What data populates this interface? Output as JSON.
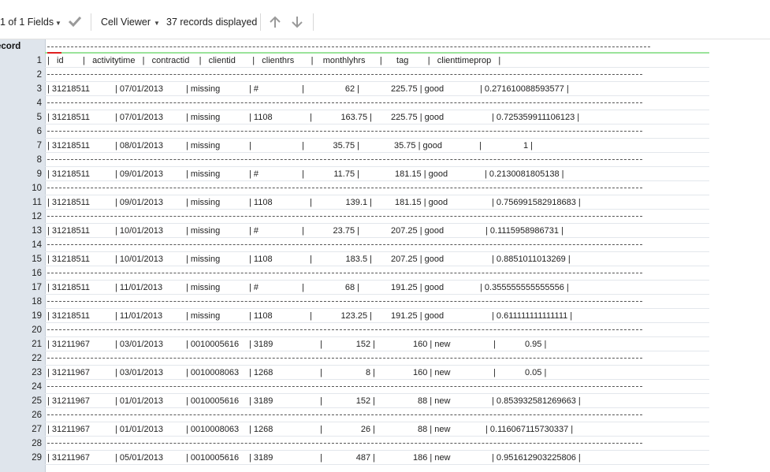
{
  "toolbar": {
    "fields_label": "1 of 1 Fields",
    "viewer_label": "Cell Viewer",
    "records_label": "37 records displayed"
  },
  "grid": {
    "rownum_header": "ecord",
    "header_row": "|   id        |   activitytime   |   contractid    |   clientid       |   clienthrs       |    monthlyhrs      |      tag        |   clienttimeprop   |",
    "rows": [
      {
        "n": "1",
        "kind": "header"
      },
      {
        "n": "2",
        "kind": "dash"
      },
      {
        "n": "3",
        "kind": "data",
        "c": [
          "| 31218511",
          "| 07/01/2013",
          "| missing",
          "| #",
          "62 |",
          "225.75 | good",
          "| 0.271610088593577 |"
        ]
      },
      {
        "n": "4",
        "kind": "dash"
      },
      {
        "n": "5",
        "kind": "data",
        "c": [
          "| 31218511",
          "| 07/01/2013",
          "| missing",
          "| 1108",
          "163.75 |",
          "225.75 | good",
          "| 0.725359911106123 |"
        ]
      },
      {
        "n": "6",
        "kind": "dash"
      },
      {
        "n": "7",
        "kind": "data",
        "c": [
          "| 31218511",
          "| 08/01/2013",
          "| missing",
          "|",
          "35.75 |",
          "35.75 | good",
          "1 |"
        ]
      },
      {
        "n": "8",
        "kind": "dash"
      },
      {
        "n": "9",
        "kind": "data",
        "c": [
          "| 31218511",
          "| 09/01/2013",
          "| missing",
          "| #",
          "11.75 |",
          "181.15 | good",
          "| 0.2130081805138 |"
        ]
      },
      {
        "n": "10",
        "kind": "dash"
      },
      {
        "n": "11",
        "kind": "data",
        "c": [
          "| 31218511",
          "| 09/01/2013",
          "| missing",
          "| 1108",
          "139.1 |",
          "181.15 | good",
          "| 0.756991582918683 |"
        ]
      },
      {
        "n": "12",
        "kind": "dash"
      },
      {
        "n": "13",
        "kind": "data",
        "c": [
          "| 31218511",
          "| 10/01/2013",
          "| missing",
          "| #",
          "23.75 |",
          "207.25 | good",
          "| 0.1115958986731 |"
        ]
      },
      {
        "n": "14",
        "kind": "dash"
      },
      {
        "n": "15",
        "kind": "data",
        "c": [
          "| 31218511",
          "| 10/01/2013",
          "| missing",
          "| 1108",
          "183.5 |",
          "207.25 | good",
          "| 0.8851011013269 |"
        ]
      },
      {
        "n": "16",
        "kind": "dash"
      },
      {
        "n": "17",
        "kind": "data",
        "c": [
          "| 31218511",
          "| 11/01/2013",
          "| missing",
          "| #",
          "68 |",
          "191.25 | good",
          "| 0.355555555555556 |"
        ]
      },
      {
        "n": "18",
        "kind": "dash"
      },
      {
        "n": "19",
        "kind": "data",
        "c": [
          "| 31218511",
          "| 11/01/2013",
          "| missing",
          "| 1108",
          "123.25 |",
          "191.25 | good",
          "| 0.611111111111111 |"
        ]
      },
      {
        "n": "20",
        "kind": "dash"
      },
      {
        "n": "21",
        "kind": "data",
        "c": [
          "| 31211967",
          "| 03/01/2013",
          "| 0010005616",
          "| 3189",
          "152 |",
          "160 | new",
          "0.95 |"
        ]
      },
      {
        "n": "22",
        "kind": "dash"
      },
      {
        "n": "23",
        "kind": "data",
        "c": [
          "| 31211967",
          "| 03/01/2013",
          "| 0010008063",
          "| 1268",
          "8 |",
          "160 | new",
          "0.05 |"
        ]
      },
      {
        "n": "24",
        "kind": "dash"
      },
      {
        "n": "25",
        "kind": "data",
        "c": [
          "| 31211967",
          "| 01/01/2013",
          "| 0010005616",
          "| 3189",
          "152 |",
          "88 | new",
          "| 0.853932581269663 |"
        ]
      },
      {
        "n": "26",
        "kind": "dash"
      },
      {
        "n": "27",
        "kind": "data",
        "c": [
          "| 31211967",
          "| 01/01/2013",
          "| 0010008063",
          "| 1268",
          "26 |",
          "88 | new",
          "| 0.116067115730337 |"
        ]
      },
      {
        "n": "28",
        "kind": "dash"
      },
      {
        "n": "29",
        "kind": "data",
        "c": [
          "| 31211967",
          "| 05/01/2013",
          "| 0010005616",
          "| 3189",
          "487 |",
          "186 | new",
          "| 0.951612903225806 |"
        ]
      }
    ]
  }
}
